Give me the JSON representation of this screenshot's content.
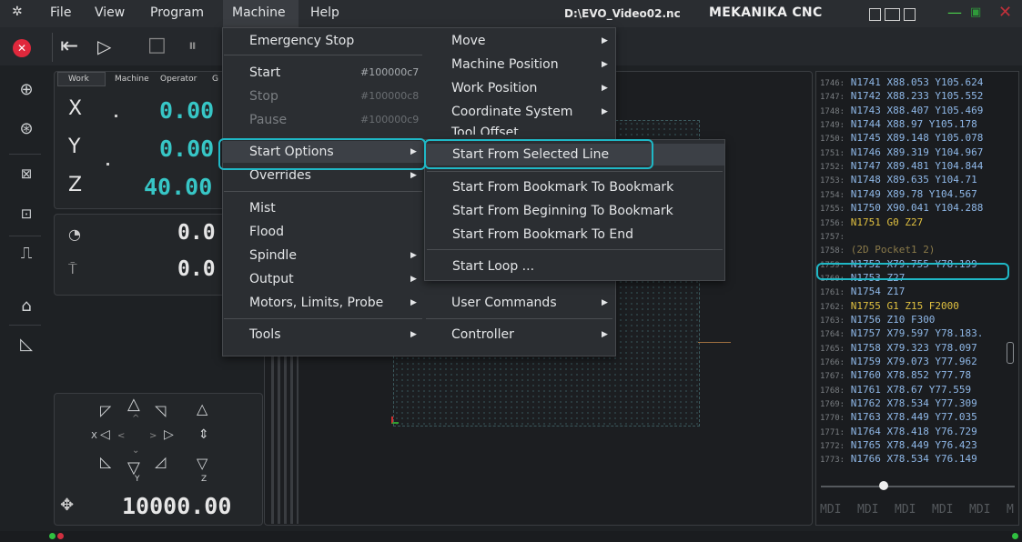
{
  "title_bar": {
    "menus": [
      "File",
      "View",
      "Program",
      "Machine",
      "Help"
    ],
    "file": "D:\\EVO_Video02.nc",
    "app": "MEKANIKA CNC"
  },
  "dro": {
    "tabs": [
      "Work",
      "Machine",
      "Operator",
      "G"
    ],
    "axes": [
      {
        "letter": "X",
        "value": "0.00"
      },
      {
        "letter": "Y",
        "value": "0.00"
      },
      {
        "letter": "Z",
        "value": "40.00"
      }
    ],
    "feed_value": "0.0",
    "spindle_value": "0.0",
    "jog_step": "10000.00",
    "jog_axis_labels": {
      "xy": "X",
      "y": "Y",
      "z": "Z"
    }
  },
  "machine_menu": {
    "items": [
      {
        "label": "Emergency Stop"
      },
      {
        "label": "Start",
        "shortcut": "#100000c7"
      },
      {
        "label": "Stop",
        "shortcut": "#100000c8",
        "disabled": true
      },
      {
        "label": "Pause",
        "shortcut": "#100000c9",
        "disabled": true
      },
      {
        "label": "Start Options",
        "submenu": true
      },
      {
        "label": "Overrides",
        "submenu": true
      },
      {
        "label": "Mist"
      },
      {
        "label": "Flood"
      },
      {
        "label": "Spindle",
        "submenu": true
      },
      {
        "label": "Output",
        "submenu": true
      },
      {
        "label": "Motors, Limits, Probe",
        "submenu": true
      },
      {
        "label": "Tools",
        "submenu": true
      }
    ]
  },
  "machine_menu_col2": {
    "items": [
      {
        "label": "Move",
        "submenu": true
      },
      {
        "label": "Machine Position",
        "submenu": true
      },
      {
        "label": "Work Position",
        "submenu": true
      },
      {
        "label": "Coordinate System",
        "submenu": true
      },
      {
        "label": "Tool Offset",
        "submenu": true
      },
      {
        "label": "User Commands",
        "submenu": true
      },
      {
        "label": "Controller",
        "submenu": true
      }
    ]
  },
  "start_options_submenu": {
    "items": [
      {
        "label": "Start From Selected Line"
      },
      {
        "label": "Start From Bookmark To Bookmark"
      },
      {
        "label": "Start From Beginning To Bookmark"
      },
      {
        "label": "Start From Bookmark To End"
      },
      {
        "label": "Start Loop ..."
      }
    ]
  },
  "code_lines": [
    {
      "num": "1746:",
      "text": "N1741 X88.053 Y105.624"
    },
    {
      "num": "1747:",
      "text": "N1742 X88.233 Y105.552"
    },
    {
      "num": "1748:",
      "text": "N1743 X88.407 Y105.469"
    },
    {
      "num": "1749:",
      "text": "N1744 X88.97 Y105.178"
    },
    {
      "num": "1750:",
      "text": "N1745 X89.148 Y105.078"
    },
    {
      "num": "1751:",
      "text": "N1746 X89.319 Y104.967"
    },
    {
      "num": "1752:",
      "text": "N1747 X89.481 Y104.844"
    },
    {
      "num": "1753:",
      "text": "N1748 X89.635 Y104.71"
    },
    {
      "num": "1754:",
      "text": "N1749 X89.78 Y104.567"
    },
    {
      "num": "1755:",
      "text": "N1750 X90.041 Y104.288"
    },
    {
      "num": "1756:",
      "text": "N1751 G0 Z27"
    },
    {
      "num": "1757:",
      "text": ""
    },
    {
      "num": "1758:",
      "text": "(2D Pocket1 2)"
    },
    {
      "num": "1759:",
      "text": "N1752 X79.755 Y78.199"
    },
    {
      "num": "1760:",
      "text": "N1753 Z27"
    },
    {
      "num": "1761:",
      "text": "N1754 Z17"
    },
    {
      "num": "1762:",
      "text": "N1755 G1 Z15 F2000"
    },
    {
      "num": "1763:",
      "text": "N1756 Z10 F300"
    },
    {
      "num": "1764:",
      "text": "N1757 X79.597 Y78.183."
    },
    {
      "num": "1765:",
      "text": "N1758 X79.323 Y78.097"
    },
    {
      "num": "1766:",
      "text": "N1759 X79.073 Y77.962"
    },
    {
      "num": "1767:",
      "text": "N1760 X78.852 Y77.78"
    },
    {
      "num": "1768:",
      "text": "N1761 X78.67 Y77.559"
    },
    {
      "num": "1769:",
      "text": "N1762 X78.534 Y77.309"
    },
    {
      "num": "1770:",
      "text": "N1763 X78.449 Y77.035"
    },
    {
      "num": "1771:",
      "text": "N1764 X78.418 Y76.729"
    },
    {
      "num": "1772:",
      "text": "N1765 X78.449 Y76.423"
    },
    {
      "num": "1773:",
      "text": "N1766 X78.534 Y76.149"
    }
  ],
  "mdi_labels": [
    "MDI",
    "MDI",
    "MDI",
    "MDI",
    "MDI",
    "M"
  ],
  "colors": {
    "accent": "#1fb8c6",
    "dro": "#37c6c6",
    "g0": "#e0c040",
    "g1": "#e0c040",
    "feed": "#d84fd8",
    "comment": "#8a7a4a",
    "code": "#8fb8e8"
  }
}
